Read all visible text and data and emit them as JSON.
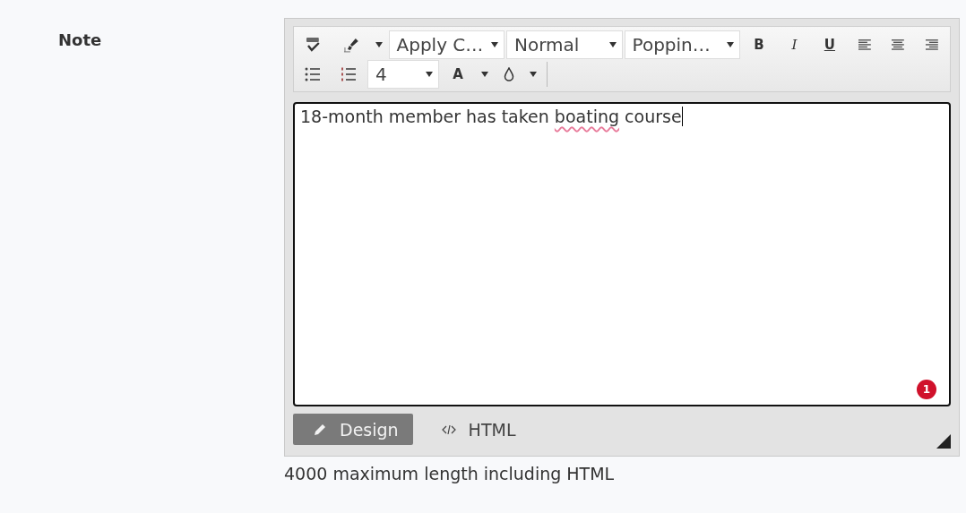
{
  "field": {
    "label": "Note"
  },
  "toolbar": {
    "row_1": [
      {
        "kind": "icon"
      },
      {
        "kind": "icon"
      },
      {
        "kind": "caret"
      },
      {
        "kind": "dropdown",
        "value": "Apply C…"
      },
      {
        "kind": "dropdown",
        "value": "Normal"
      },
      {
        "kind": "dropdown",
        "value": "Poppin…"
      },
      {
        "kind": "text",
        "text": "B"
      },
      {
        "kind": "text",
        "text": "I"
      },
      {
        "kind": "text",
        "text": "U"
      },
      {
        "kind": "icon"
      },
      {
        "kind": "icon"
      },
      {
        "kind": "icon"
      }
    ],
    "row_2": [
      {
        "kind": "icon"
      },
      {
        "kind": "icon"
      },
      {
        "kind": "dropdown",
        "value": "4"
      },
      {
        "kind": "text",
        "text": "A"
      },
      {
        "kind": "caret"
      },
      {
        "kind": "icon"
      },
      {
        "kind": "caret"
      }
    ]
  },
  "content": [
    {
      "text": "18-month member has taken ",
      "misspelled": false
    },
    {
      "text": "boating",
      "misspelled": true
    },
    {
      "text": " course",
      "misspelled": false
    }
  ],
  "issues_badge": "1",
  "modes": [
    {
      "label": "Design",
      "selected": true
    },
    {
      "label": "HTML",
      "selected": false
    }
  ],
  "hint": "4000 maximum length including HTML"
}
